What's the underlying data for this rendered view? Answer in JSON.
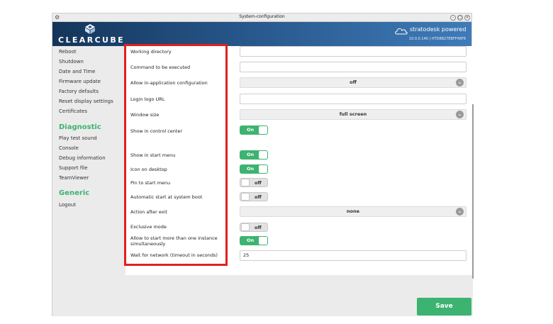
{
  "window": {
    "title": "System-configuration",
    "controls": [
      "minimize",
      "maximize",
      "close"
    ]
  },
  "header": {
    "brand": "CLEARCUBE",
    "powered_by": "stratodesk powered",
    "version": "10.0.0.140",
    "device_id": "HTD8827EBFF46F8"
  },
  "sidebar": {
    "items_top": [
      "Reboot",
      "Shutdown",
      "Date and Time",
      "Firmware update",
      "Factory defaults",
      "Reset display settings",
      "Certificates"
    ],
    "diagnostic_title": "Diagnostic",
    "diagnostic_items": [
      "Play test sound",
      "Console",
      "Debug information",
      "Support file",
      "TeamViewer"
    ],
    "generic_title": "Generic",
    "generic_items": [
      "Logout"
    ]
  },
  "form": {
    "working_directory": {
      "label": "Working directory",
      "value": ""
    },
    "command": {
      "label": "Command to be executed",
      "value": ""
    },
    "in_app_config": {
      "label": "Allow in-application configuration",
      "value": "off"
    },
    "login_logo": {
      "label": "Login logo URL",
      "value": ""
    },
    "window_size": {
      "label": "Window size",
      "value": "full screen"
    },
    "show_control_center": {
      "label": "Show in control center",
      "state": "On"
    },
    "show_start_menu": {
      "label": "Show in start menu",
      "state": "On"
    },
    "icon_desktop": {
      "label": "Icon on desktop",
      "state": "On"
    },
    "pin_start": {
      "label": "Pin to start menu",
      "state": "off"
    },
    "autostart": {
      "label": "Automatic start at system boot",
      "state": "off"
    },
    "action_after_exit": {
      "label": "Action after exit",
      "value": "none"
    },
    "exclusive_mode": {
      "label": "Exclusive mode",
      "state": "off"
    },
    "multi_instance": {
      "label_line1": "Allow to start more than one instance",
      "label_line2": "simultaneously",
      "state": "On"
    },
    "wait_network": {
      "label": "Wait for network (timeout in seconds)",
      "value": "25"
    }
  },
  "actions": {
    "save": "Save"
  },
  "colors": {
    "accent_green": "#3cb371",
    "highlight_red": "#e0201e",
    "header_blue": "#27568a"
  }
}
